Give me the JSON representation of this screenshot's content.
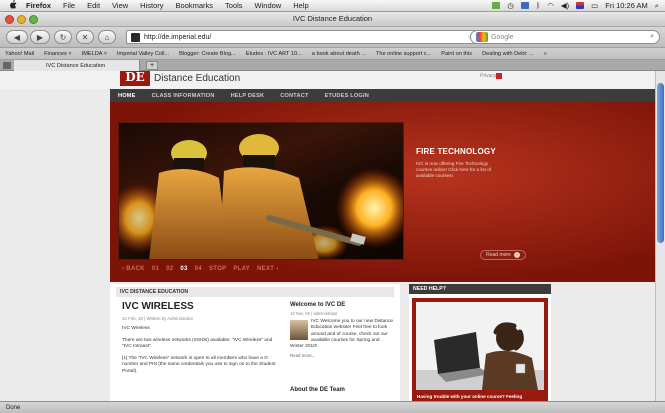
{
  "menubar": {
    "apple": "",
    "app": "Firefox",
    "items": [
      "File",
      "Edit",
      "View",
      "History",
      "Bookmarks",
      "Tools",
      "Window",
      "Help"
    ],
    "clock": "Fri 10:26 AM"
  },
  "window": {
    "title": "IVC Distance Education"
  },
  "nav": {
    "url": "http://de.imperial.edu/",
    "search_placeholder": "Google"
  },
  "bookmarks": [
    "Yahoo! Mail",
    "Finances ˅",
    "IMELDA ˅",
    "Imperial Valley Coll...",
    "Blogger: Create Blog...",
    "Etudes : IVC ART 10...",
    "a book about death ...",
    "The online support c...",
    "Paint on this",
    "Dealing with Debt: ..."
  ],
  "tabs": [
    {
      "label": "IVC Distance Education"
    }
  ],
  "status": "Done",
  "site": {
    "logo": "DE",
    "logo_text": "Distance Education",
    "top_links": "Privacy",
    "top_links_red": "",
    "nav": [
      "HOME",
      "CLASS INFORMATION",
      "HELP DESK",
      "CONTACT",
      "ETUDES LOGIN"
    ],
    "hero": {
      "title": "FIRE TECHNOLOGY",
      "desc": "IVC is now offering Fire Technology courses online! Click here for a list of available courses!",
      "readmore": "Read more",
      "slides": [
        "‹ BACK",
        "01",
        "02",
        "03",
        "04",
        "STOP",
        "PLAY",
        "NEXT ›"
      ],
      "current_slide": "03"
    },
    "content_header": "IVC DISTANCE EDUCATION",
    "article": {
      "title": "IVC WIRELESS",
      "meta": "10 Feb, 10  |  Written by Administrator",
      "paragraphs": [
        "IVC Wireless",
        "There are two wireless networks (SSIDs) available: \"IVC Wireless\" and \"IVC Intranet\".",
        "[1]   The \"IVC Wireless\" network is open to all members who have a G number and PIN (the same credentials you use to sign on to the Student Portal)."
      ]
    },
    "welcome": {
      "title": "Welcome to IVC DE",
      "meta": "12 Nov, 09  |  administrator",
      "text": "IVC Welcome you to our new Distance Education website! Feel free to look around and of course, check out our available courses for Spring and Winter 2010!",
      "readmore": "Read more..."
    },
    "team": "About the DE Team",
    "help": {
      "header": "NEED HELP?",
      "caption": "Having trouble with your online course? Feeling"
    }
  },
  "colors": {
    "brand_red": "#9b1a10",
    "nav_dark": "#3c3c3c",
    "hero_red": "#b8341e"
  }
}
